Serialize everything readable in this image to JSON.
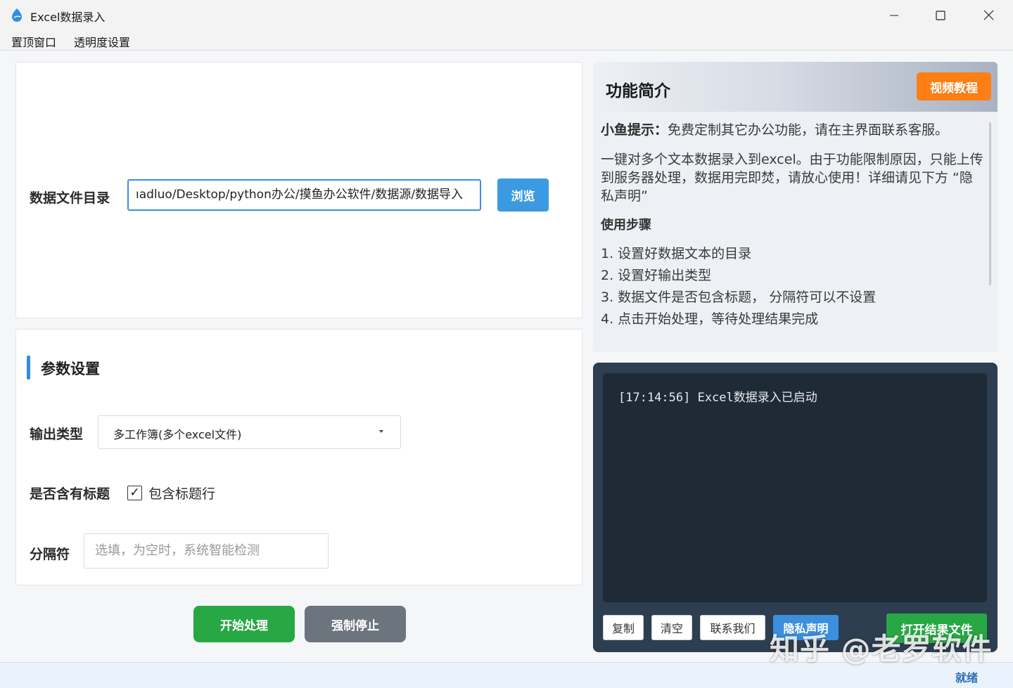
{
  "window": {
    "title": "Excel数据录入",
    "icon": "whale-droplet-icon",
    "controls": [
      "minimize",
      "maximize",
      "close"
    ]
  },
  "menu": {
    "items": [
      "置顶窗口",
      "透明度设置"
    ]
  },
  "data_dir": {
    "label": "数据文件目录",
    "value": "ıadluo/Desktop/python办公/摸鱼办公软件/数据源/数据导入",
    "browse_label": "浏览"
  },
  "params": {
    "section_title": "参数设置",
    "output_type_label": "输出类型",
    "output_type_value": "多工作簿(多个excel文件)",
    "header_label": "是否含有标题",
    "header_checkbox_label": "包含标题行",
    "header_checked": true,
    "check_mark": "✓",
    "separator_label": "分隔符",
    "separator_placeholder": "选填，为空时，系统智能检测"
  },
  "actions": {
    "start_label": "开始处理",
    "stop_label": "强制停止"
  },
  "info": {
    "title": "功能简介",
    "video_label": "视频教程",
    "tip_label": "小鱼提示：",
    "tip_text": "免费定制其它办公功能，请在主界面联系客服。",
    "description": "一键对多个文本数据录入到excel。由于功能限制原因，只能上传到服务器处理，数据用完即焚，请放心使用！详细请见下方 “隐私声明”",
    "steps_title": "使用步骤",
    "steps": [
      "1. 设置好数据文本的目录",
      "2. 设置好输出类型",
      "3. 数据文件是否包含标题， 分隔符可以不设置",
      "4. 点击开始处理，等待处理结果完成"
    ]
  },
  "log": {
    "lines": [
      "[17:14:56] Excel数据录入已启动"
    ],
    "buttons": {
      "copy": "复制",
      "clear": "清空",
      "contact": "联系我们",
      "privacy": "隐私声明",
      "open_result": "打开结果文件"
    }
  },
  "status": {
    "text": "就绪"
  },
  "watermark": "知乎 @老罗软件",
  "colors": {
    "primary_blue": "#3b9ae1",
    "accent_orange": "#fd7e14",
    "success_green": "#28a745",
    "stop_gray": "#6c757d",
    "log_bg": "#2d3e50"
  }
}
